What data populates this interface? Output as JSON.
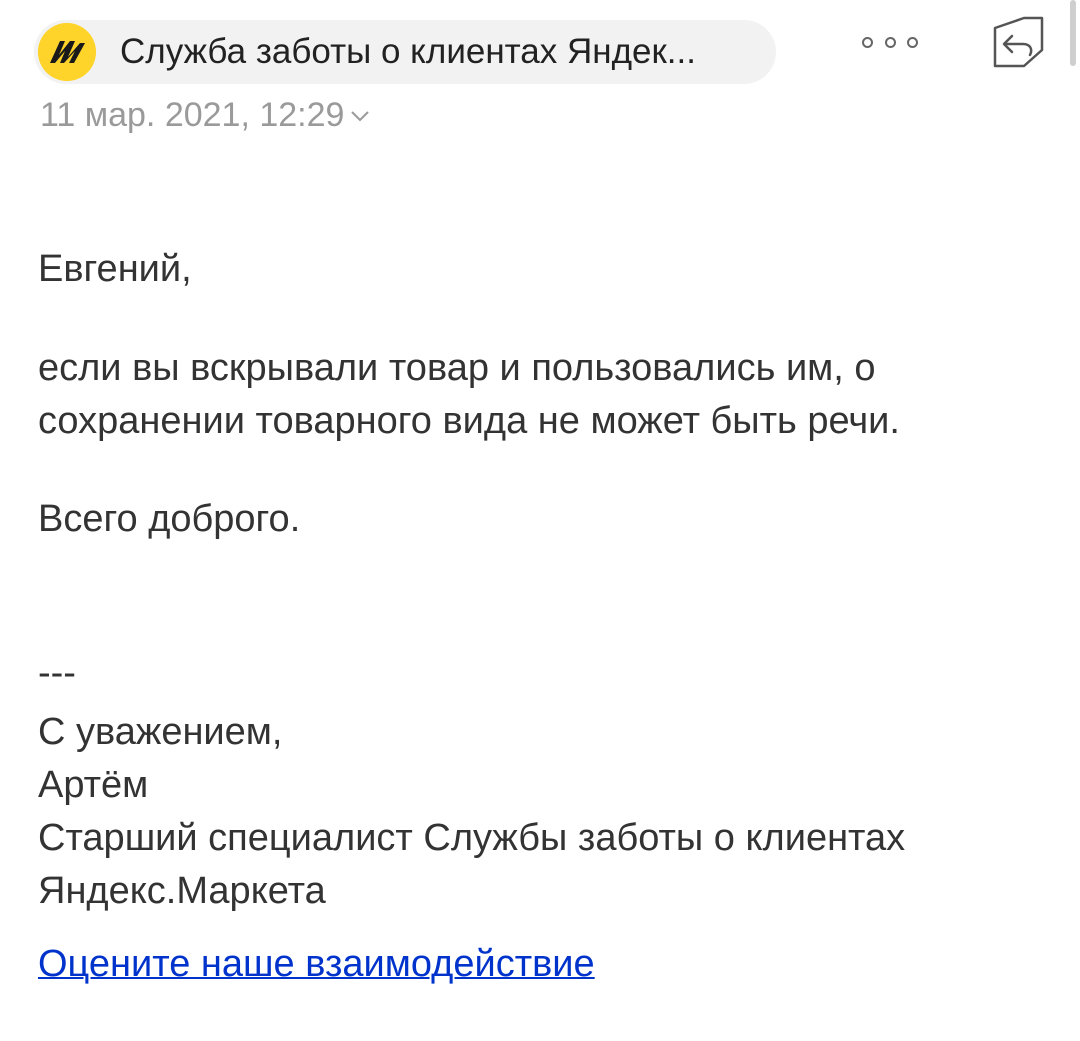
{
  "header": {
    "sender_name": "Служба заботы о клиентах Яндек...",
    "date": "11 мар. 2021, 12:29",
    "avatar_icon": "yandex-market-logo",
    "more_icon": "more-dots-icon",
    "reply_icon": "reply-icon"
  },
  "body": {
    "greeting": "Евгений,",
    "paragraph1_line1": "если вы вскрывали товар и пользовались им, о",
    "paragraph1_line2": "сохранении товарного вида не может быть речи.",
    "paragraph2": "Всего доброго.",
    "separator": "---",
    "signature_line1": "С уважением,",
    "signature_line2": "Артём",
    "signature_line3": "Старший специалист Службы заботы о клиентах",
    "signature_line4": "Яндекс.Маркета",
    "rate_link": "Оцените наше взаимодействие"
  },
  "colors": {
    "avatar_bg": "#fed42b",
    "link": "#0033cc",
    "muted": "#9a9a9a"
  }
}
